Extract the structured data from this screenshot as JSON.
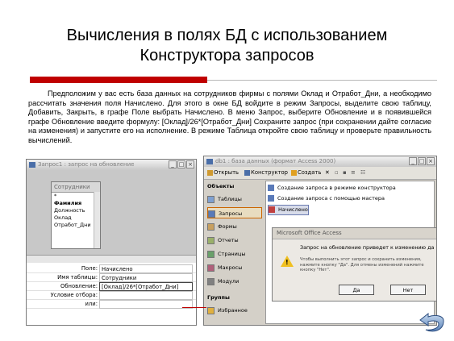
{
  "slide": {
    "title_line1": "Вычисления в полях БД с использованием",
    "title_line2": "Конструктора запросов",
    "paragraph": "Предположим у вас есть база данных на сотрудников фирмы с полями Оклад и Отработ_Дни, а необходимо рассчитать значения поля Начислено. Для этого в окне БД войдите в режим Запросы, выделите свою таблицу, Добавить, Закрыть, в графе Поле выбрать Начислено. В меню Запрос, выберите Обновление и в появившейся графе Обновление введите формулу: [Оклад]/26*[Отработ_Дни]  Сохраните запрос (при сохранении дайте согласие на изменения) и запустите его на исполнение. В режиме Таблица откройте свою таблицу и проверьте правильность вычислений.",
    "accent_color": "#c00000"
  },
  "query_window": {
    "title": "Запрос1 : запрос на обновление",
    "table_name": "Сотрудники",
    "fields": [
      "*",
      "Фамилия",
      "Должность",
      "Оклад",
      "Отработ_Дни"
    ],
    "grid": [
      {
        "label": "Поле:",
        "value": "Начислено"
      },
      {
        "label": "Имя таблицы:",
        "value": "Сотрудники"
      },
      {
        "label": "Обновление:",
        "value": "[Оклад]/26*[Отработ_Дни]"
      },
      {
        "label": "Условие отбора:",
        "value": ""
      },
      {
        "label": "или:",
        "value": ""
      }
    ]
  },
  "db_window": {
    "title": "db1 : база данных (формат Access 2000)",
    "toolbar": [
      "Открыть",
      "Конструктор",
      "Создать"
    ],
    "nav_header": "Объекты",
    "nav": [
      "Таблицы",
      "Запросы",
      "Формы",
      "Отчеты",
      "Страницы",
      "Макросы",
      "Модули"
    ],
    "nav_selected": "Запросы",
    "groups_label": "Группы",
    "favorites": "Избранное",
    "items": [
      "Создание запроса в режиме конструктора",
      "Создание запроса с помощью мастера",
      "Начислено"
    ]
  },
  "dialog": {
    "title": "Microsoft Office Access",
    "message": "Запрос на обновление приведет к изменению данных в таблице.",
    "detail": "Чтобы выполнить этот запрос и сохранить изменения, нажмите кнопку \"Да\". Для отмены изменений нажмите кнопку \"Нет\".",
    "yes": "Да",
    "no": "Нет"
  }
}
